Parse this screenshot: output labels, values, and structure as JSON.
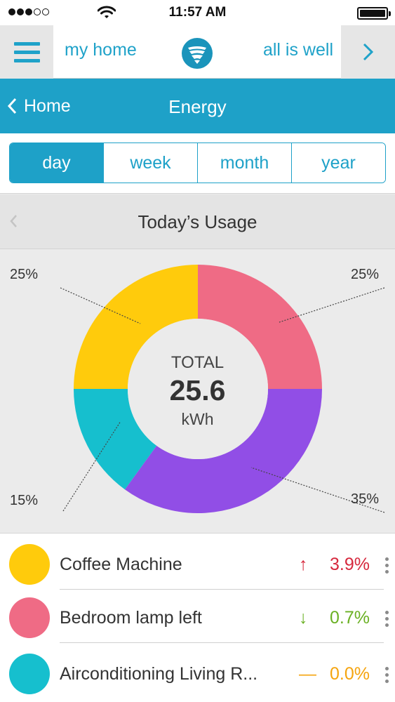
{
  "status_bar": {
    "time": "11:57 AM"
  },
  "header": {
    "home_label": "my home",
    "status_message": "all is well"
  },
  "nav": {
    "back_label": "Home",
    "title": "Energy"
  },
  "periods": [
    {
      "label": "day",
      "active": true
    },
    {
      "label": "week",
      "active": false
    },
    {
      "label": "month",
      "active": false
    },
    {
      "label": "year",
      "active": false
    }
  ],
  "usage": {
    "title": "Today’s Usage"
  },
  "total": {
    "label": "TOTAL",
    "value": "25.6",
    "unit": "kWh"
  },
  "chart_data": {
    "type": "pie",
    "variant": "donut",
    "center_label": "TOTAL",
    "center_value": 25.6,
    "center_unit": "kWh",
    "slices": [
      {
        "value": 25,
        "label": "25%",
        "color": "#ef6b85"
      },
      {
        "value": 35,
        "label": "35%",
        "color": "#914ee6"
      },
      {
        "value": 15,
        "label": "15%",
        "color": "#16bfce"
      },
      {
        "value": 25,
        "label": "25%",
        "color": "#ffcb0c"
      }
    ]
  },
  "devices": [
    {
      "name": "Coffee Machine",
      "color": "#ffcb0c",
      "trend_icon": "arrow-up-icon",
      "trend_symbol": "↑",
      "change": "3.9%",
      "change_color": "#d6283d"
    },
    {
      "name": "Bedroom lamp left",
      "color": "#ef6b85",
      "trend_icon": "arrow-down-icon",
      "trend_symbol": "↓",
      "change": "0.7%",
      "change_color": "#6ab023"
    },
    {
      "name": "Airconditioning Living R...",
      "color": "#16bfce",
      "trend_icon": "dash-icon",
      "trend_symbol": "—",
      "change": "0.0%",
      "change_color": "#f5a40e"
    }
  ],
  "icons": {
    "menu": "hamburger-menu-icon",
    "logo": "brand-logo-icon",
    "next": "chevron-right-icon",
    "back": "chevron-left-icon",
    "prev": "chevron-left-icon",
    "more": "kebab-menu-icon"
  },
  "colors": {
    "accent": "#1ea1c8",
    "accent_dark": "#1a94bb"
  }
}
